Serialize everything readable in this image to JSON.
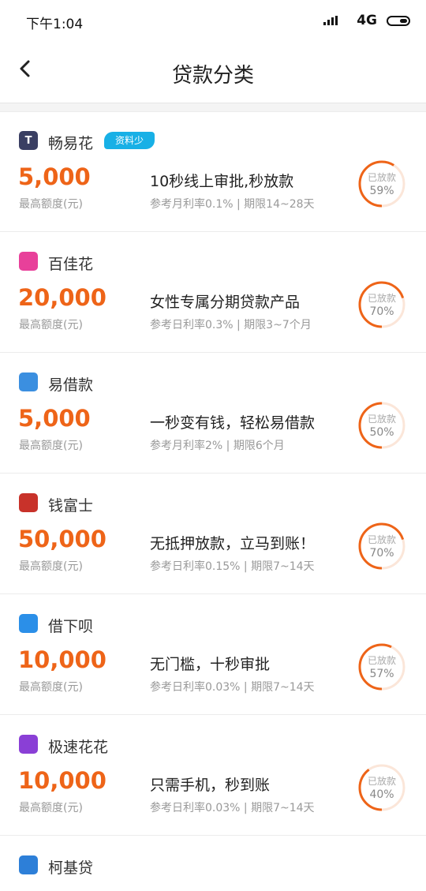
{
  "status_bar": {
    "time": "下午1:04",
    "network": "4G"
  },
  "header": {
    "title": "贷款分类"
  },
  "amount_label": "最高额度(元)",
  "ring_label": "已放款",
  "colors": {
    "accent": "#ee6418",
    "tag": "#18b0e6",
    "ring_bg": "#fbe6d9"
  },
  "loans": [
    {
      "name": "畅易花",
      "tag": "资料少",
      "amount": "5,000",
      "desc": "10秒线上审批,秒放款",
      "meta": "参考月利率0.1% | 期限14~28天",
      "rate_text": "59%",
      "rate": 0.59,
      "logo_color": "#3a3f63",
      "logo_glyph": "T"
    },
    {
      "name": "百佳花",
      "tag": "",
      "amount": "20,000",
      "desc": "女性专属分期贷款产品",
      "meta": "参考日利率0.3% | 期限3~7个月",
      "rate_text": "70%",
      "rate": 0.7,
      "logo_color": "#e8409a",
      "logo_glyph": ""
    },
    {
      "name": "易借款",
      "tag": "",
      "amount": "5,000",
      "desc": "一秒变有钱，轻松易借款",
      "meta": "参考月利率2% | 期限6个月",
      "rate_text": "50%",
      "rate": 0.5,
      "logo_color": "#3b8fe0",
      "logo_glyph": ""
    },
    {
      "name": "钱富士",
      "tag": "",
      "amount": "50,000",
      "desc": "无抵押放款，立马到账！",
      "meta": "参考日利率0.15% | 期限7~14天",
      "rate_text": "70%",
      "rate": 0.7,
      "logo_color": "#c8322a",
      "logo_glyph": ""
    },
    {
      "name": "借下呗",
      "tag": "",
      "amount": "10,000",
      "desc": "无门槛，十秒审批",
      "meta": "参考日利率0.03% | 期限7~14天",
      "rate_text": "57%",
      "rate": 0.57,
      "logo_color": "#2b8fe8",
      "logo_glyph": ""
    },
    {
      "name": "极速花花",
      "tag": "",
      "amount": "10,000",
      "desc": "只需手机，秒到账",
      "meta": "参考日利率0.03% | 期限7~14天",
      "rate_text": "40%",
      "rate": 0.4,
      "logo_color": "#8a3fd6",
      "logo_glyph": ""
    }
  ],
  "partial_item": {
    "name": "柯基贷",
    "logo_color": "#2d7fd8"
  }
}
